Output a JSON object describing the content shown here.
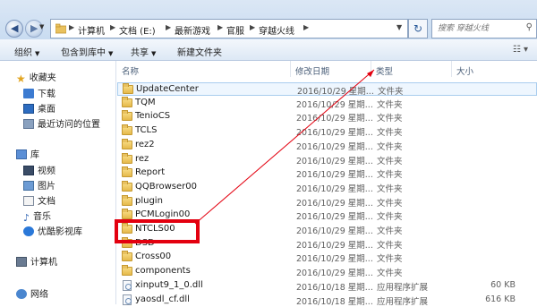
{
  "address": {
    "breadcrumbs": [
      "计算机",
      "文档 (E:)",
      "最新游戏",
      "官服",
      "穿越火线"
    ],
    "search_placeholder": "搜索 穿越火线"
  },
  "toolbar": {
    "organize": "组织",
    "include_library": "包含到库中",
    "share": "共享",
    "new_folder": "新建文件夹"
  },
  "sidebar": {
    "favorites": "收藏夹",
    "download": "下载",
    "desktop": "桌面",
    "recent": "最近访问的位置",
    "libraries": "库",
    "video": "视频",
    "pictures": "图片",
    "documents": "文档",
    "music": "音乐",
    "youku": "优酷影视库",
    "computer": "计算机",
    "network": "网络"
  },
  "columns": {
    "name": "名称",
    "date": "修改日期",
    "type": "类型",
    "size": "大小"
  },
  "files": [
    {
      "name": "UpdateCenter",
      "date": "2016/10/29 星期...",
      "type": "文件夹",
      "size": "",
      "kind": "folder"
    },
    {
      "name": "TQM",
      "date": "2016/10/29 星期...",
      "type": "文件夹",
      "size": "",
      "kind": "folder"
    },
    {
      "name": "TenioCS",
      "date": "2016/10/29 星期...",
      "type": "文件夹",
      "size": "",
      "kind": "folder"
    },
    {
      "name": "TCLS",
      "date": "2016/10/29 星期...",
      "type": "文件夹",
      "size": "",
      "kind": "folder"
    },
    {
      "name": "rez2",
      "date": "2016/10/29 星期...",
      "type": "文件夹",
      "size": "",
      "kind": "folder"
    },
    {
      "name": "rez",
      "date": "2016/10/29 星期...",
      "type": "文件夹",
      "size": "",
      "kind": "folder"
    },
    {
      "name": "Report",
      "date": "2016/10/29 星期...",
      "type": "文件夹",
      "size": "",
      "kind": "folder"
    },
    {
      "name": "QQBrowser00",
      "date": "2016/10/29 星期...",
      "type": "文件夹",
      "size": "",
      "kind": "folder"
    },
    {
      "name": "plugin",
      "date": "2016/10/29 星期...",
      "type": "文件夹",
      "size": "",
      "kind": "folder"
    },
    {
      "name": "PCMLogin00",
      "date": "2016/10/29 星期...",
      "type": "文件夹",
      "size": "",
      "kind": "folder"
    },
    {
      "name": "NTCLS00",
      "date": "2016/10/29 星期...",
      "type": "文件夹",
      "size": "",
      "kind": "folder"
    },
    {
      "name": "DSD",
      "date": "2016/10/29 星期...",
      "type": "文件夹",
      "size": "",
      "kind": "folder"
    },
    {
      "name": "Cross00",
      "date": "2016/10/29 星期...",
      "type": "文件夹",
      "size": "",
      "kind": "folder"
    },
    {
      "name": "components",
      "date": "2016/10/29 星期...",
      "type": "文件夹",
      "size": "",
      "kind": "folder"
    },
    {
      "name": "xinput9_1_0.dll",
      "date": "2016/10/18 星期...",
      "type": "应用程序扩展",
      "size": "60 KB",
      "kind": "dll"
    },
    {
      "name": "yaosdl_cf.dll",
      "date": "2016/10/18 星期...",
      "type": "应用程序扩展",
      "size": "616 KB",
      "kind": "dll"
    }
  ]
}
